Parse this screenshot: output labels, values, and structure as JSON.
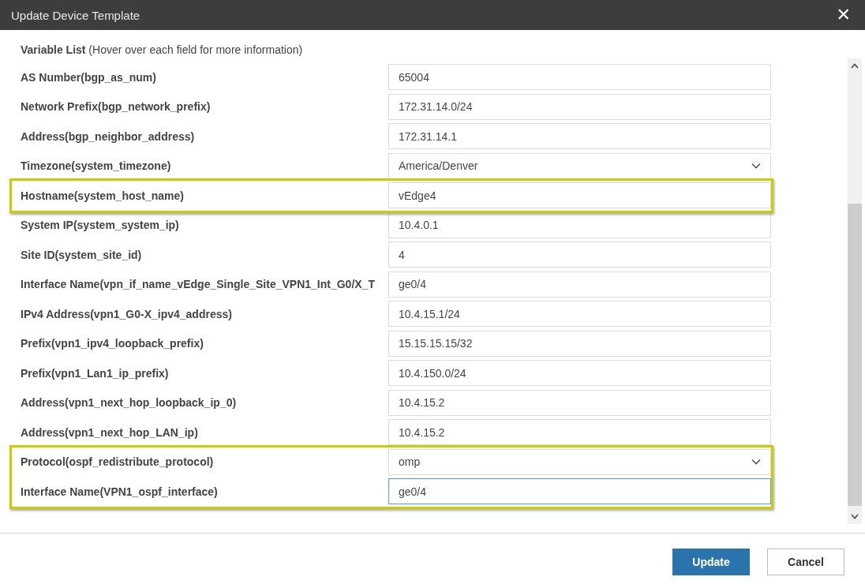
{
  "window": {
    "title": "Update Device Template",
    "close": "✕"
  },
  "heading": "**Variable List** (Hover over each field for more information)",
  "rows": [
    {
      "label": "AS Number(bgp_as_num)",
      "kind": "text",
      "value": "65004",
      "highlighted": false,
      "focused": false
    },
    {
      "label": "Network Prefix(bgp_network_prefix)",
      "kind": "text",
      "value": "172.31.14.0/24",
      "highlighted": false,
      "focused": false
    },
    {
      "label": "Address(bgp_neighbor_address)",
      "kind": "text",
      "value": "172.31.14.1",
      "highlighted": false,
      "focused": false
    },
    {
      "label": "Timezone(system_timezone)",
      "kind": "select",
      "value": "America/Denver",
      "highlighted": false,
      "focused": false
    },
    {
      "label": "Hostname(system_host_name)",
      "kind": "text",
      "value": "vEdge4",
      "highlighted": true,
      "focused": false
    },
    {
      "label": "System IP(system_system_ip)",
      "kind": "text",
      "value": "10.4.0.1",
      "highlighted": false,
      "focused": false
    },
    {
      "label": "Site ID(system_site_id)",
      "kind": "text",
      "value": "4",
      "highlighted": false,
      "focused": false
    },
    {
      "label": "Interface Name(vpn_if_name_vEdge_Single_Site_VPN1_Int_G0/X_T",
      "kind": "text",
      "value": "ge0/4",
      "highlighted": false,
      "focused": false
    },
    {
      "label": "IPv4 Address(vpn1_G0-X_ipv4_address)",
      "kind": "text",
      "value": "10.4.15.1/24",
      "highlighted": false,
      "focused": false
    },
    {
      "label": "Prefix(vpn1_ipv4_loopback_prefix)",
      "kind": "text",
      "value": "15.15.15.15/32",
      "highlighted": false,
      "focused": false
    },
    {
      "label": "Prefix(vpn1_Lan1_ip_prefix)",
      "kind": "text",
      "value": "10.4.150.0/24",
      "highlighted": false,
      "focused": false
    },
    {
      "label": "Address(vpn1_next_hop_loopback_ip_0)",
      "kind": "text",
      "value": "10.4.15.2",
      "highlighted": false,
      "focused": false
    },
    {
      "label": "Address(vpn1_next_hop_LAN_ip)",
      "kind": "text",
      "value": "10.4.15.2",
      "highlighted": false,
      "focused": false
    },
    {
      "label": "Protocol(ospf_redistribute_protocol)",
      "kind": "select",
      "value": "omp",
      "highlighted": true,
      "focused": false
    },
    {
      "label": "Interface Name(VPN1_ospf_interface)",
      "kind": "text",
      "value": "ge0/4",
      "highlighted": true,
      "focused": true
    }
  ],
  "buttons": [
    {
      "label": "Update",
      "kind": "primary"
    },
    {
      "label": "Cancel",
      "kind": "secondary"
    }
  ]
}
